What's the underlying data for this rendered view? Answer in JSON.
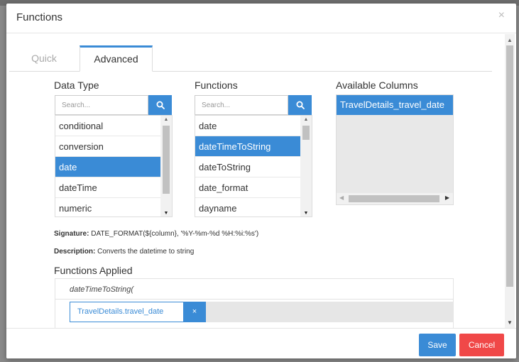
{
  "modal": {
    "title": "Functions",
    "close": "×"
  },
  "tabs": [
    {
      "label": "Quick",
      "active": false
    },
    {
      "label": "Advanced",
      "active": true
    }
  ],
  "data_type": {
    "title": "Data Type",
    "search_placeholder": "Search...",
    "items": [
      "conditional",
      "conversion",
      "date",
      "dateTime",
      "numeric"
    ],
    "selected": "date"
  },
  "functions": {
    "title": "Functions",
    "search_placeholder": "Search...",
    "items": [
      "date",
      "dateTimeToString",
      "dateToString",
      "date_format",
      "dayname"
    ],
    "selected": "dateTimeToString"
  },
  "available_columns": {
    "title": "Available Columns",
    "items": [
      "TravelDetails_travel_date"
    ]
  },
  "signature": {
    "label": "Signature:",
    "value": "DATE_FORMAT(${column}, '%Y-%m-%d %H:%i:%s')"
  },
  "description": {
    "label": "Description:",
    "value": "Converts the datetime to string"
  },
  "functions_applied": {
    "title": "Functions Applied",
    "expression": "dateTimeToString(",
    "chip_label": "TravelDetails.travel_date",
    "chip_remove": "×"
  },
  "footer": {
    "save_label": "Save",
    "cancel_label": "Cancel"
  },
  "colors": {
    "accent": "#3a8bd6",
    "danger": "#f04848"
  }
}
